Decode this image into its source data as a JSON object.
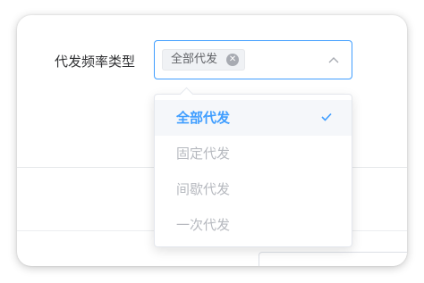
{
  "form": {
    "label": "代发频率类型"
  },
  "select": {
    "selected_tags": [
      "全部代发"
    ],
    "arrow_icon": "chevron-up-icon",
    "tag_close_icon": "close-circle-icon",
    "accent_color": "#409eff"
  },
  "dropdown": {
    "options": [
      {
        "label": "全部代发",
        "selected": true
      },
      {
        "label": "固定代发",
        "selected": false
      },
      {
        "label": "间歇代发",
        "selected": false
      },
      {
        "label": "一次代发",
        "selected": false
      }
    ],
    "check_icon": "check-icon"
  }
}
